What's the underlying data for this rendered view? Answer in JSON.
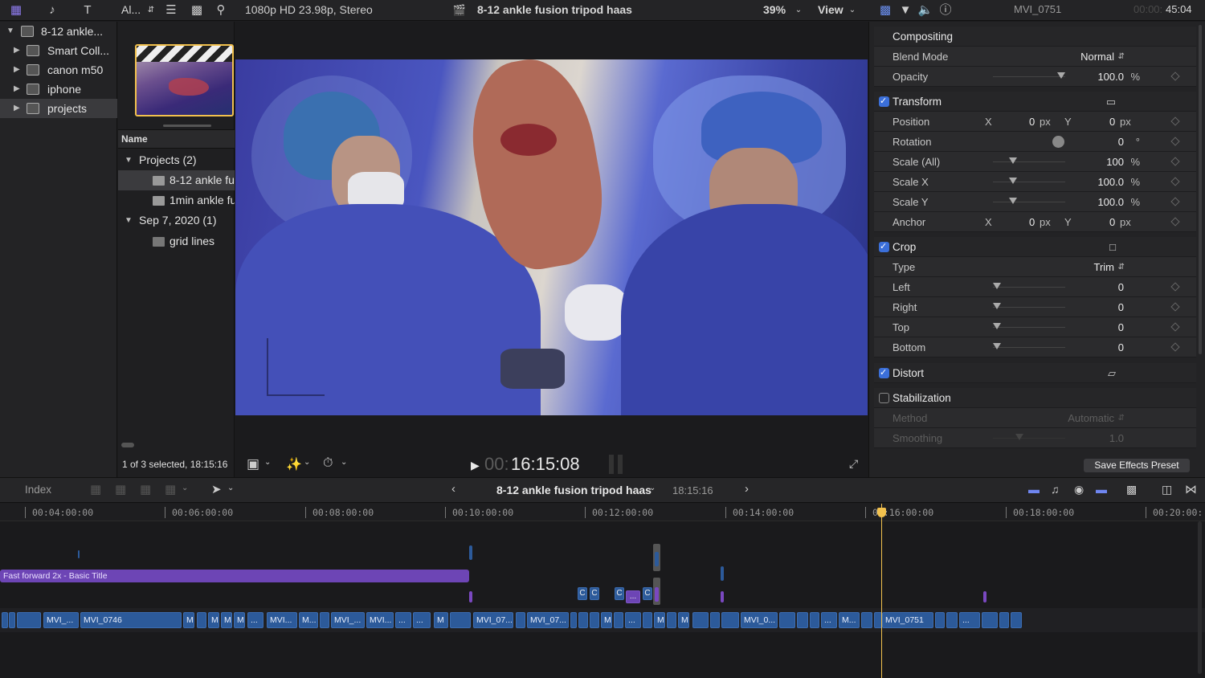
{
  "toolbar": {
    "library_filter": "Al...",
    "format": "1080p HD 23.98p, Stereo",
    "project_title": "8-12 ankle fusion tripod haas",
    "zoom": "39%",
    "view_label": "View",
    "inspector_clip": "MVI_0751",
    "inspector_timecode_dim": "00:00:",
    "inspector_timecode": "45:04"
  },
  "library": {
    "items": [
      {
        "label": "8-12 ankle..."
      },
      {
        "label": "Smart Coll..."
      },
      {
        "label": "canon m50"
      },
      {
        "label": "iphone"
      },
      {
        "label": "projects"
      }
    ]
  },
  "browser": {
    "column_name": "Name",
    "groups": [
      {
        "label": "Projects  (2)",
        "items": [
          "8-12 ankle fu",
          "1min ankle fu"
        ]
      },
      {
        "label": "Sep 7, 2020  (1)",
        "items": [
          "grid lines"
        ]
      }
    ],
    "status": "1 of 3 selected, 18:15:16"
  },
  "viewer": {
    "timecode_dim": "00:",
    "timecode": "16:15:08"
  },
  "inspector": {
    "compositing": {
      "header": "Compositing",
      "blend_mode_label": "Blend Mode",
      "blend_mode_value": "Normal",
      "opacity_label": "Opacity",
      "opacity_value": "100.0",
      "opacity_unit": "%"
    },
    "transform": {
      "header": "Transform",
      "position_label": "Position",
      "position_x": "0",
      "position_y": "0",
      "rotation_label": "Rotation",
      "rotation_value": "0",
      "rotation_unit": "°",
      "scale_all_label": "Scale (All)",
      "scale_all_value": "100",
      "scale_x_label": "Scale X",
      "scale_x_value": "100.0",
      "scale_y_label": "Scale Y",
      "scale_y_value": "100.0",
      "anchor_label": "Anchor",
      "anchor_x": "0",
      "anchor_y": "0",
      "x": "X",
      "y": "Y",
      "px": "px",
      "pct": "%"
    },
    "crop": {
      "header": "Crop",
      "type_label": "Type",
      "type_value": "Trim",
      "left_label": "Left",
      "left_value": "0",
      "right_label": "Right",
      "right_value": "0",
      "top_label": "Top",
      "top_value": "0",
      "bottom_label": "Bottom",
      "bottom_value": "0"
    },
    "distort": {
      "header": "Distort"
    },
    "stabilization": {
      "header": "Stabilization",
      "method_label": "Method",
      "method_value": "Automatic",
      "smoothing_label": "Smoothing",
      "smoothing_value": "1.0"
    },
    "save_preset": "Save Effects Preset"
  },
  "timeline": {
    "index_label": "Index",
    "project_title": "8-12 ankle fusion tripod haas",
    "duration": "18:15:16",
    "ruler": [
      "00:04:00:00",
      "00:06:00:00",
      "00:08:00:00",
      "00:10:00:00",
      "00:12:00:00",
      "00:14:00:00",
      "00:16:00:00",
      "00:18:00:00",
      "00:20:00:"
    ],
    "title_clip": "Fast forward 2x - Basic Title",
    "clip_labels": {
      "mvi_a": "MVI_...",
      "mvi_0746": "MVI_0746",
      "mvi_b": "MVI...",
      "m_dots": "M...",
      "mvi_c": "MVI_...",
      "mvi_d": "MVI...",
      "mvi_07a": "MVI_07...",
      "mvi_07b": "MVI_07...",
      "mvi_0b": "MVI_0...",
      "m_dots2": "M...",
      "mvi_0751": "MVI_0751",
      "m": "M",
      "dots": "...",
      "c": "C"
    }
  }
}
